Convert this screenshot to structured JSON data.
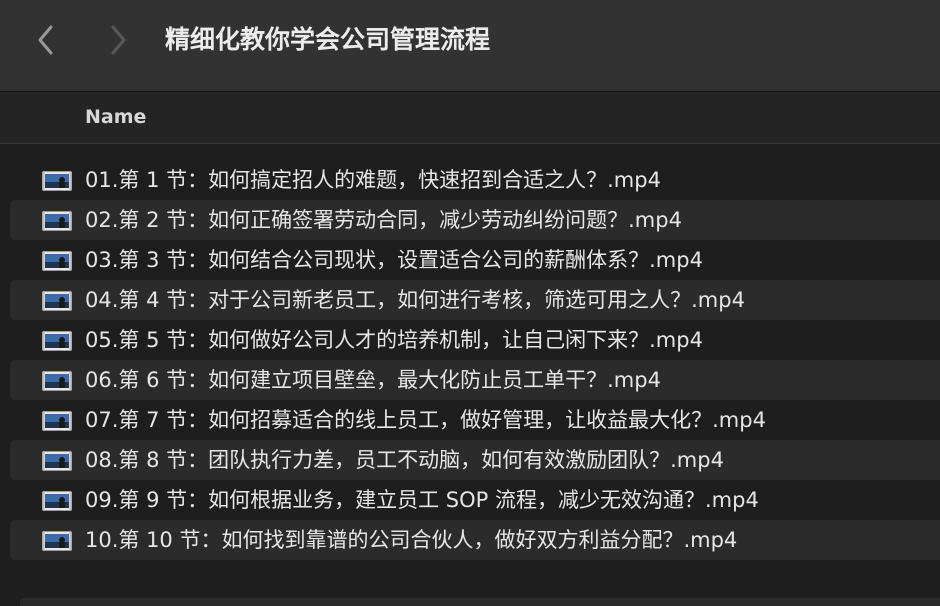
{
  "window": {
    "title": "精细化教你学会公司管理流程"
  },
  "toolbar": {
    "back_icon": "chevron-left-icon",
    "forward_icon": "chevron-right-icon"
  },
  "header": {
    "name_column": "Name"
  },
  "files": [
    {
      "name": "01.第 1 节：如何搞定招人的难题，快速招到合适之人？.mp4",
      "icon": "video-file-icon"
    },
    {
      "name": "02.第 2 节：如何正确签署劳动合同，减少劳动纠纷问题？.mp4",
      "icon": "video-file-icon"
    },
    {
      "name": "03.第 3 节：如何结合公司现状，设置适合公司的薪酬体系？.mp4",
      "icon": "video-file-icon"
    },
    {
      "name": "04.第 4 节：对于公司新老员工，如何进行考核，筛选可用之人？.mp4",
      "icon": "video-file-icon"
    },
    {
      "name": "05.第 5 节：如何做好公司人才的培养机制，让自己闲下来？.mp4",
      "icon": "video-file-icon"
    },
    {
      "name": "06.第 6 节：如何建立项目壁垒，最大化防止员工单干？.mp4",
      "icon": "video-file-icon"
    },
    {
      "name": "07.第 7 节：如何招募适合的线上员工，做好管理，让收益最大化？.mp4",
      "icon": "video-file-icon"
    },
    {
      "name": "08.第 8 节：团队执行力差，员工不动脑，如何有效激励团队？.mp4",
      "icon": "video-file-icon"
    },
    {
      "name": "09.第 9 节：如何根据业务，建立员工 SOP 流程，减少无效沟通？.mp4",
      "icon": "video-file-icon"
    },
    {
      "name": "10.第 10 节：如何找到靠谱的公司合伙人，做好双方利益分配？.mp4",
      "icon": "video-file-icon"
    }
  ],
  "colors": {
    "titlebar": "#323232",
    "background": "#1e1e1e",
    "row_alt": "#2b2b2b",
    "text": "#e6e6e6"
  }
}
